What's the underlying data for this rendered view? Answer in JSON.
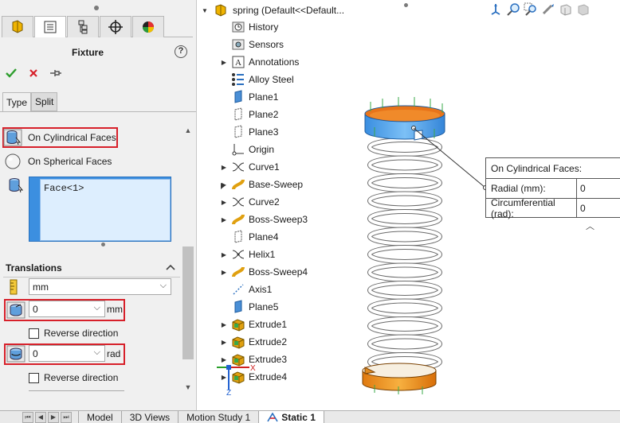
{
  "property_manager": {
    "title": "Fixture",
    "help_glyph": "?",
    "tabs": [
      {
        "name": "feature-manager-tab",
        "icon": "feature-manager-icon"
      },
      {
        "name": "property-manager-tab",
        "icon": "property-manager-icon"
      },
      {
        "name": "configuration-manager-tab",
        "icon": "configuration-manager-icon"
      },
      {
        "name": "dimxpert-manager-tab",
        "icon": "dimxpert-icon"
      },
      {
        "name": "display-manager-tab",
        "icon": "display-manager-icon"
      }
    ],
    "sub_tabs": [
      "Type",
      "Split"
    ],
    "type_options": [
      {
        "label": "On Cylindrical Faces",
        "icon": "cylindrical-face-icon",
        "highlighted": true
      },
      {
        "label": "On Spherical Faces",
        "icon": "spherical-face-icon",
        "highlighted": false
      }
    ],
    "selected_faces": [
      "Face<1>"
    ],
    "translations": {
      "header": "Translations",
      "unit_select": "mm",
      "fields": [
        {
          "value": "0",
          "unit": "mm",
          "reverse_label": "Reverse direction"
        },
        {
          "value": "0",
          "unit": "rad",
          "reverse_label": "Reverse direction"
        }
      ]
    },
    "colors": {
      "highlight_red": "#d7202a",
      "selection_blue": "#3c8fe0",
      "accept_green": "#2e9e2e"
    }
  },
  "feature_tree": {
    "root": "spring  (Default<<Default...",
    "items": [
      {
        "label": "History",
        "icon": "history-icon",
        "expandable": false
      },
      {
        "label": "Sensors",
        "icon": "sensors-icon",
        "expandable": false
      },
      {
        "label": "Annotations",
        "icon": "annotations-icon",
        "expandable": true
      },
      {
        "label": "Alloy Steel",
        "icon": "material-icon",
        "expandable": false
      },
      {
        "label": "Plane1",
        "icon": "plane-icon",
        "expandable": false
      },
      {
        "label": "Plane2",
        "icon": "plane-icon",
        "expandable": false
      },
      {
        "label": "Plane3",
        "icon": "plane-icon",
        "expandable": false
      },
      {
        "label": "Origin",
        "icon": "origin-icon",
        "expandable": false
      },
      {
        "label": "Curve1",
        "icon": "curve-icon",
        "expandable": true
      },
      {
        "label": "Base-Sweep",
        "icon": "sweep-icon",
        "expandable": true
      },
      {
        "label": "Curve2",
        "icon": "curve-icon",
        "expandable": true
      },
      {
        "label": "Boss-Sweep3",
        "icon": "sweep-icon",
        "expandable": true
      },
      {
        "label": "Plane4",
        "icon": "plane-icon",
        "expandable": false
      },
      {
        "label": "Helix1",
        "icon": "helix-icon",
        "expandable": true
      },
      {
        "label": "Boss-Sweep4",
        "icon": "sweep-icon",
        "expandable": true
      },
      {
        "label": "Axis1",
        "icon": "axis-icon",
        "expandable": false
      },
      {
        "label": "Plane5",
        "icon": "plane-icon",
        "expandable": false
      },
      {
        "label": "Extrude1",
        "icon": "extrude-icon",
        "expandable": true
      },
      {
        "label": "Extrude2",
        "icon": "extrude-icon",
        "expandable": true
      },
      {
        "label": "Extrude3",
        "icon": "extrude-icon",
        "expandable": true
      },
      {
        "label": "Extrude4",
        "icon": "extrude-icon",
        "expandable": true
      }
    ]
  },
  "callout": {
    "rows": [
      {
        "label": "On Cylindrical Faces:",
        "value": ""
      },
      {
        "label": "Radial (mm):",
        "value": "0"
      },
      {
        "label": "Circumferential (rad):",
        "value": "0"
      }
    ]
  },
  "triad": {
    "x": "X",
    "y": "Y",
    "z": "Z"
  },
  "bottom_tabs": [
    "Model",
    "3D Views",
    "Motion Study 1",
    "Static 1"
  ],
  "active_bottom_tab": "Static 1",
  "view_toolbar": [
    "view-orientation-icon",
    "zoom-to-fit-icon",
    "zoom-area-icon",
    "previous-view-icon",
    "section-view-icon",
    "display-style-icon"
  ]
}
